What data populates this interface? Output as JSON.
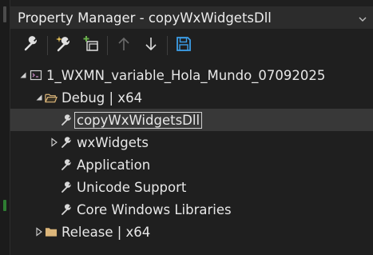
{
  "window": {
    "title": "Property Manager - copyWxWidgetsDll"
  },
  "toolbar": {
    "buttons": [
      {
        "icon": "wrench-icon",
        "enabled": true
      },
      {
        "icon": "wrench-sparkle-icon",
        "enabled": true
      },
      {
        "icon": "add-existing-property-sheet-icon",
        "enabled": true
      },
      {
        "icon": "arrow-up-icon",
        "enabled": false
      },
      {
        "icon": "arrow-down-icon",
        "enabled": true
      },
      {
        "icon": "save-icon",
        "enabled": true
      }
    ]
  },
  "tree": {
    "project": "1_WXMN_variable_Hola_Mundo_07092025",
    "debug_config": "Debug | x64",
    "sheets": [
      {
        "label": "copyWxWidgetsDll",
        "selected": true,
        "expandable": false
      },
      {
        "label": "wxWidgets",
        "selected": false,
        "expandable": true
      },
      {
        "label": "Application",
        "selected": false,
        "expandable": false
      },
      {
        "label": "Unicode Support",
        "selected": false,
        "expandable": false
      },
      {
        "label": "Core Windows Libraries",
        "selected": false,
        "expandable": false
      }
    ],
    "release_config": "Release | x64"
  },
  "colors": {
    "background": "#1f1f1f",
    "title_bar": "#2c2c2c",
    "selection": "#383838",
    "save_blue": "#3c9ee8",
    "add_green": "#6ab04c",
    "folder_yellow": "#dcb67a"
  }
}
